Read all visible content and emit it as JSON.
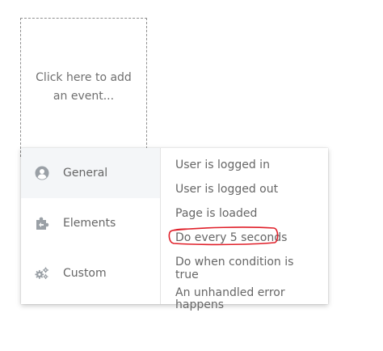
{
  "placeholder": {
    "text": "Click here to add an event..."
  },
  "categories": [
    {
      "label": "General",
      "icon": "user-circle-icon",
      "active": true
    },
    {
      "label": "Elements",
      "icon": "puzzle-piece-icon",
      "active": false
    },
    {
      "label": "Custom",
      "icon": "gears-icon",
      "active": false
    }
  ],
  "events": [
    {
      "label": "User is logged in"
    },
    {
      "label": "User is logged out"
    },
    {
      "label": "Page is loaded"
    },
    {
      "label": "Do every 5 seconds",
      "highlighted": true
    },
    {
      "label": "Do when condition is true"
    },
    {
      "label": "An unhandled error happens"
    }
  ],
  "colors": {
    "text": "#666666",
    "icon": "#9aa0a6",
    "active_bg": "#f4f6f8",
    "highlight_stroke": "#e0202a"
  }
}
